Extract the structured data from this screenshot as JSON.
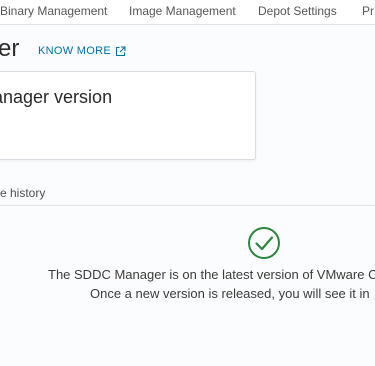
{
  "nav": {
    "tabs": [
      {
        "label": "Binary Management"
      },
      {
        "label": "Image Management"
      },
      {
        "label": "Depot Settings"
      },
      {
        "label": "Pr"
      }
    ]
  },
  "header": {
    "title": "er",
    "know_more_label": "KNOW MORE",
    "know_more_icon": "external-link-icon"
  },
  "card": {
    "title": "anager version"
  },
  "tabs": {
    "history_label": "e history"
  },
  "status": {
    "icon": "check-circle-icon",
    "icon_color": "#2e8540",
    "line1": "The SDDC Manager is on the latest version of VMware C",
    "line2": "Once a new version is released, you will see it in"
  },
  "colors": {
    "accent": "#0072a3",
    "success": "#2e8540"
  }
}
